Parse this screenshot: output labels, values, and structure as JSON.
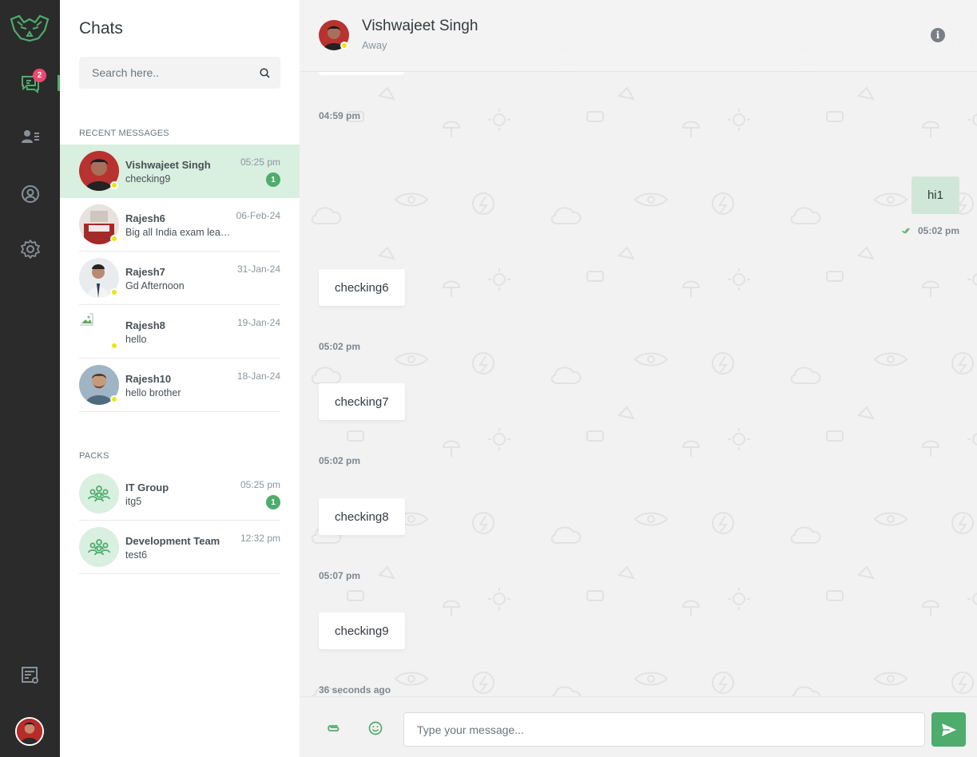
{
  "rail": {
    "unread_badge": "2",
    "icons": [
      "wolf-logo-icon",
      "chats-icon",
      "contacts-icon",
      "profile-icon",
      "settings-icon",
      "server-settings-icon",
      "user-avatar"
    ]
  },
  "panel": {
    "title": "Chats",
    "search": {
      "placeholder": "Search here.."
    },
    "recent_title": "RECENT MESSAGES",
    "chats": [
      {
        "name": "Vishwajeet Singh",
        "message": "checking9",
        "time": "05:25 pm",
        "unread": "1",
        "active": true
      },
      {
        "name": "Rajesh6",
        "message": "Big all India exam leak:...",
        "time": "06-Feb-24"
      },
      {
        "name": "Rajesh7",
        "message": "Gd Afternoon",
        "time": "31-Jan-24"
      },
      {
        "name": "Rajesh8",
        "message": "hello",
        "time": "19-Jan-24"
      },
      {
        "name": "Rajesh10",
        "message": "hello brother",
        "time": "18-Jan-24"
      }
    ],
    "packs_title": "PACKS",
    "packs": [
      {
        "name": "IT Group",
        "message": "itg5",
        "time": "05:25 pm",
        "unread": "1"
      },
      {
        "name": "Development Team",
        "message": "test6",
        "time": "12:32 pm"
      }
    ]
  },
  "conversation": {
    "contact_name": "Vishwajeet Singh",
    "contact_status": "Away",
    "timestamps": {
      "t1": "04:59 pm",
      "t2": "05:02 pm",
      "t3": "05:02 pm",
      "t4": "05:07 pm",
      "t5": "36 seconds ago"
    },
    "messages": {
      "out1": "hi1",
      "out1_time": "05:02 pm",
      "in1": "checking6",
      "in2": "checking7",
      "in3": "checking8",
      "in4": "checking9"
    },
    "composer": {
      "placeholder": "Type your message..."
    }
  },
  "colors": {
    "accent": "#4eac6d",
    "rail_bg": "#2b2b2b",
    "active_row": "#d9efe0",
    "away_dot": "#e8e80a",
    "badge_red": "#ef476f"
  }
}
